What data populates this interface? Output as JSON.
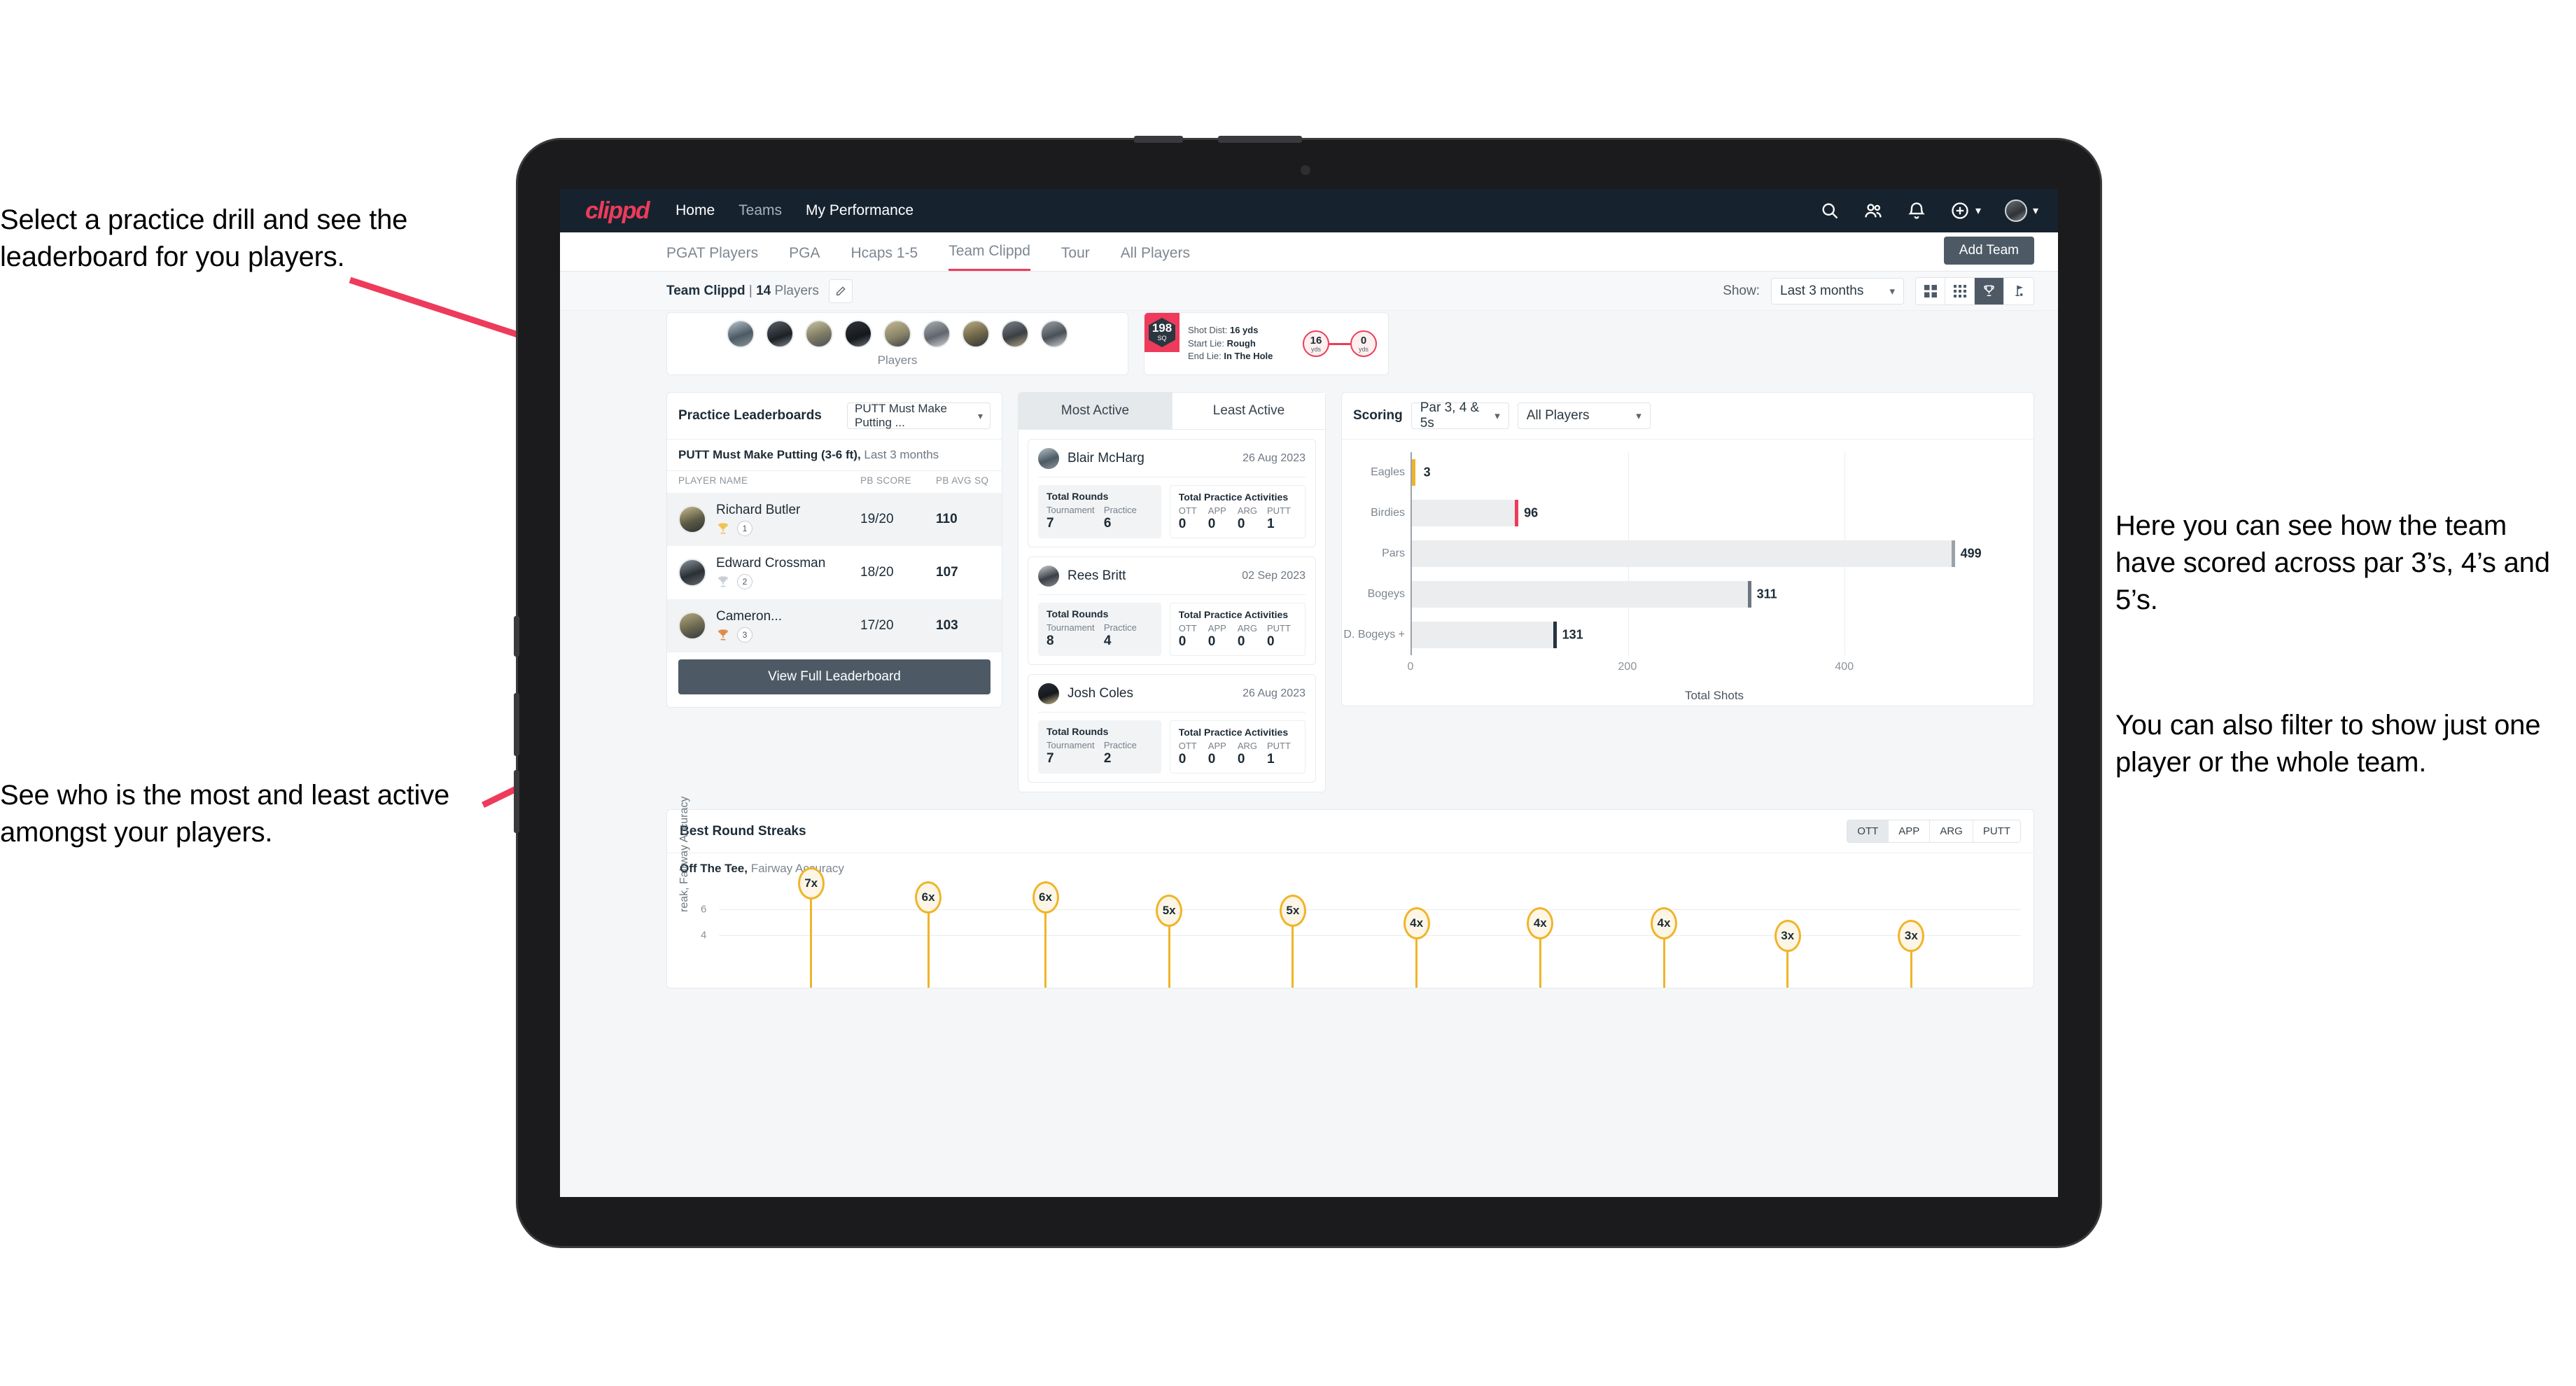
{
  "annotations": {
    "top_left": "Select a practice drill and see the leaderboard for you players.",
    "bottom_left": "See who is the most and least active amongst your players.",
    "right_1": "Here you can see how the team have scored across par 3’s, 4’s and 5’s.",
    "right_2": "You can also filter to show just one player or the whole team."
  },
  "navbar": {
    "logo": "clippd",
    "links": [
      {
        "label": "Home",
        "dim": false
      },
      {
        "label": "Teams",
        "dim": true
      },
      {
        "label": "My Performance",
        "dim": false
      }
    ],
    "icons": [
      "search-icon",
      "people-icon",
      "bell-icon",
      "plus-circle-icon",
      "avatar"
    ]
  },
  "tabs": [
    {
      "label": "PGAT Players",
      "active": false
    },
    {
      "label": "PGA",
      "active": false
    },
    {
      "label": "Hcaps 1-5",
      "active": false
    },
    {
      "label": "Team Clippd",
      "active": true
    },
    {
      "label": "Tour",
      "active": false
    },
    {
      "label": "All Players",
      "active": false
    }
  ],
  "add_team_label": "Add Team",
  "toolbar": {
    "team_name": "Team Clippd",
    "separator": " | ",
    "player_count": "14",
    "players_word": " Players",
    "show_label": "Show:",
    "range_value": "Last 3 months",
    "view_modes": [
      "grid-view-icon",
      "dots-view-icon",
      "trophy-view-icon",
      "flag-view-icon"
    ],
    "active_view": "trophy-view-icon"
  },
  "players_card": {
    "caption": "Players",
    "avatar_count": 9
  },
  "shot_card": {
    "sq_value": "198",
    "sq_unit": "SQ",
    "lines": [
      {
        "label": "Shot Dist: ",
        "value": "16 yds"
      },
      {
        "label": "Start Lie: ",
        "value": "Rough"
      },
      {
        "label": "End Lie: ",
        "value": "In The Hole"
      }
    ],
    "start_dist": "16",
    "start_unit": "yds",
    "end_dist": "0",
    "end_unit": "yds"
  },
  "leaderboard": {
    "title": "Practice Leaderboards",
    "drill_selected": "PUTT Must Make Putting ...",
    "subtitle_bold": "PUTT Must Make Putting (3-6 ft),",
    "subtitle_dim": " Last 3 months",
    "columns": [
      "PLAYER NAME",
      "PB SCORE",
      "PB AVG SQ"
    ],
    "rows": [
      {
        "name": "Richard Butler",
        "rank": "1",
        "score": "19/20",
        "sq": "110",
        "trophy": "gold"
      },
      {
        "name": "Edward Crossman",
        "rank": "2",
        "score": "18/20",
        "sq": "107",
        "trophy": "silver"
      },
      {
        "name": "Cameron...",
        "rank": "3",
        "score": "17/20",
        "sq": "103",
        "trophy": "bronze"
      }
    ],
    "button_label": "View Full Leaderboard"
  },
  "activity": {
    "tabs": [
      {
        "label": "Most Active",
        "active": true
      },
      {
        "label": "Least Active",
        "active": false
      }
    ],
    "rounds_title": "Total Rounds",
    "rounds_cols": [
      "Tournament",
      "Practice"
    ],
    "acts_title": "Total Practice Activities",
    "acts_cols": [
      "OTT",
      "APP",
      "ARG",
      "PUTT"
    ],
    "cards": [
      {
        "name": "Blair McHarg",
        "date": "26 Aug 2023",
        "rounds": [
          "7",
          "6"
        ],
        "acts": [
          "0",
          "0",
          "0",
          "1"
        ]
      },
      {
        "name": "Rees Britt",
        "date": "02 Sep 2023",
        "rounds": [
          "8",
          "4"
        ],
        "acts": [
          "0",
          "0",
          "0",
          "0"
        ]
      },
      {
        "name": "Josh Coles",
        "date": "26 Aug 2023",
        "rounds": [
          "7",
          "2"
        ],
        "acts": [
          "0",
          "0",
          "0",
          "1"
        ]
      }
    ]
  },
  "scoring": {
    "title": "Scoring",
    "par_filter": "Par 3, 4 & 5s",
    "player_filter": "All Players"
  },
  "streaks": {
    "title": "Best Round Streaks",
    "toggles": [
      {
        "label": "OTT",
        "active": true
      },
      {
        "label": "APP",
        "active": false
      },
      {
        "label": "ARG",
        "active": false
      },
      {
        "label": "PUTT",
        "active": false
      }
    ],
    "subtitle_bold": "Off The Tee,",
    "subtitle_dim": " Fairway Accuracy"
  },
  "chart_data": [
    {
      "type": "bar",
      "orientation": "horizontal",
      "title": "Scoring",
      "categories": [
        "Eagles",
        "Birdies",
        "Pars",
        "Bogeys",
        "D. Bogeys +"
      ],
      "values": [
        3,
        96,
        499,
        311,
        131
      ],
      "cap_colors": [
        "#f0b429",
        "#ee3b5b",
        "#9aa2a9",
        "#6d7781",
        "#263340"
      ],
      "xlabel": "Total Shots",
      "ylabel": "",
      "xlim": [
        0,
        560
      ],
      "xticks": [
        0,
        200,
        400
      ],
      "grid": true,
      "legend": "none"
    },
    {
      "type": "bar",
      "orientation": "vertical-lollipop",
      "title": "Best Round Streaks — Off The Tee, Fairway Accuracy",
      "categories": [
        "",
        "",
        "",
        "",
        "",
        "",
        "",
        "",
        "",
        "",
        ""
      ],
      "values": [
        7,
        6,
        6,
        5,
        5,
        4,
        4,
        4,
        3,
        3
      ],
      "value_labels": [
        "7x",
        "6x",
        "6x",
        "5x",
        "5x",
        "4x",
        "4x",
        "4x",
        "3x",
        "3x"
      ],
      "ylabel": "reak, Fairway Accuracy",
      "ylim": [
        0,
        8
      ],
      "yticks": [
        4,
        6
      ],
      "grid": true,
      "legend": "none"
    }
  ]
}
